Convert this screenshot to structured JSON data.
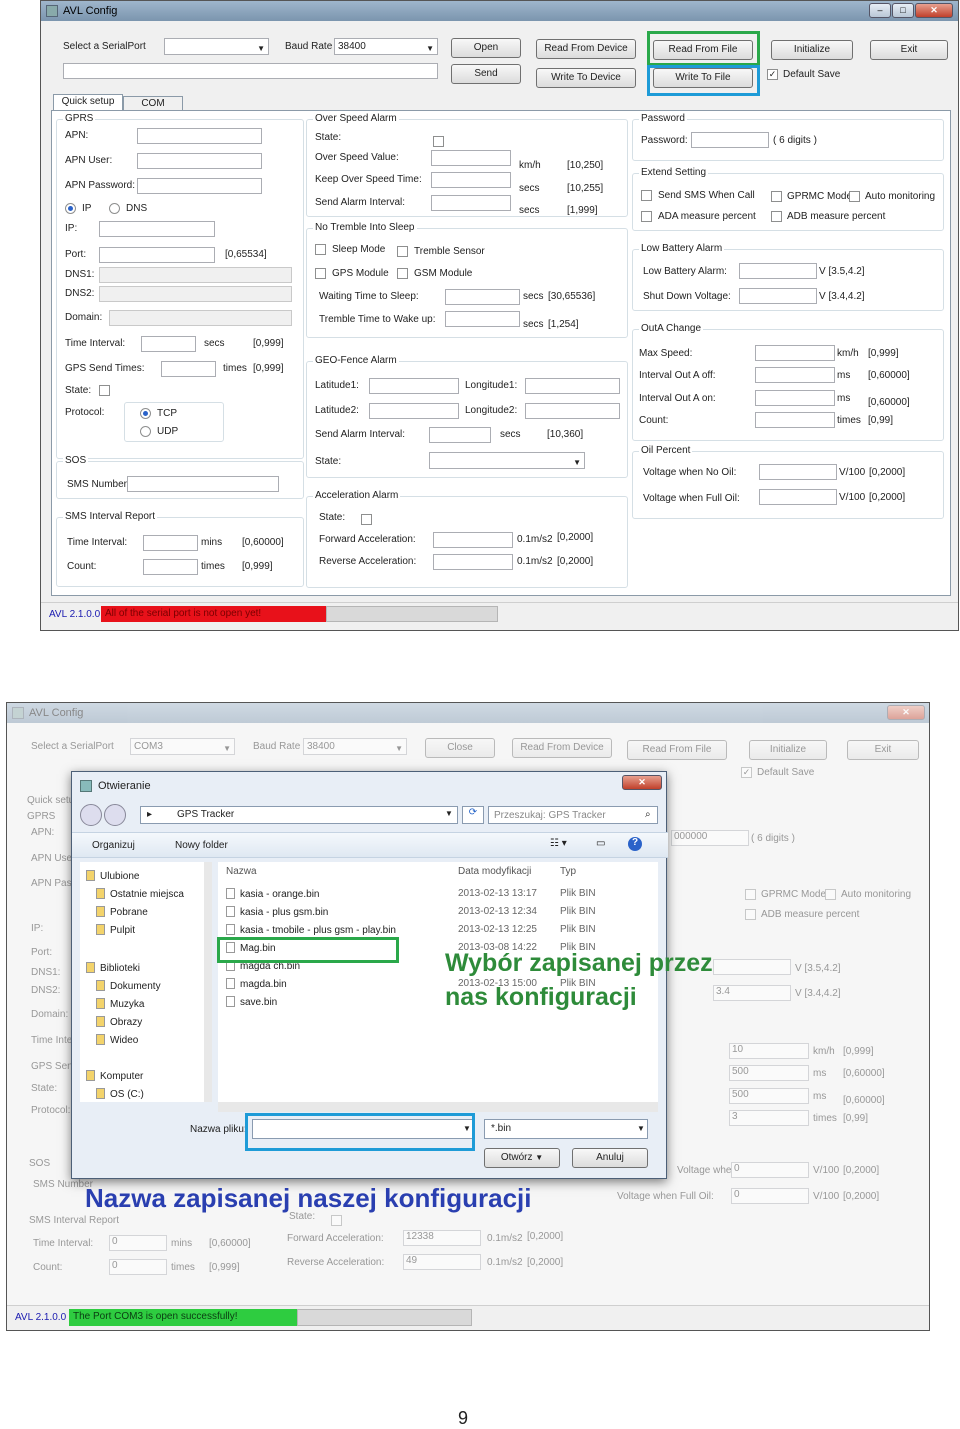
{
  "top": {
    "title": "AVL Config",
    "serial_label": "Select a SerialPort",
    "serial_value": "",
    "baud_label": "Baud Rate",
    "baud_value": "38400",
    "open": "Open",
    "send": "Send",
    "read_device": "Read  From  Device",
    "write_device": "Write To Device",
    "read_file": "Read From File",
    "write_file": "Write To File",
    "initialize": "Initialize",
    "exit": "Exit",
    "default_save": "Default Save",
    "tab_quick": "Quick setup",
    "tab_com": "COM",
    "gprs": {
      "title": "GPRS",
      "apn": "APN:",
      "apn_user": "APN User:",
      "apn_password": "APN Password:",
      "ip_opt": "IP",
      "dns_opt": "DNS",
      "ip": "IP:",
      "port": "Port:",
      "port_range": "[0,65534]",
      "dns1": "DNS1:",
      "dns2": "DNS2:",
      "domain": "Domain:",
      "time_interval": "Time Interval:",
      "secs": "secs",
      "ti_range": "[0,999]",
      "gps_send": "GPS Send Times:",
      "times": "times",
      "gs_range": "[0,999]",
      "state": "State:",
      "protocol": "Protocol:",
      "tcp": "TCP",
      "udp": "UDP"
    },
    "sos": {
      "title": "SOS",
      "sms_number": "SMS Number"
    },
    "smsr": {
      "title": "SMS Interval Report",
      "time_interval": "Time Interval:",
      "mins": "mins",
      "ti_range": "[0,60000]",
      "count": "Count:",
      "times": "times",
      "c_range": "[0,999]"
    },
    "osa": {
      "title": "Over Speed Alarm",
      "state": "State:",
      "value": "Over Speed Value:",
      "kmh": "km/h",
      "v_range": "[10,250]",
      "keep": "Keep Over Speed Time:",
      "secs": "secs",
      "k_range": "[10,255]",
      "send": "Send Alarm Interval:",
      "s_range": "[1,999]"
    },
    "nts": {
      "title": "No Tremble Into Sleep",
      "sleep_mode": "Sleep Mode",
      "tremble_sensor": "Tremble Sensor",
      "gps_module": "GPS Module",
      "gsm_module": "GSM Module",
      "waiting": "Waiting Time to Sleep:",
      "w_unit": "secs",
      "w_range": "[30,65536]",
      "tremble": "Tremble Time to Wake up:",
      "t_unit": "secs",
      "t_range": "[1,254]"
    },
    "geo": {
      "title": "GEO-Fence Alarm",
      "lat1": "Latitude1:",
      "lon1": "Longitude1:",
      "lat2": "Latitude2:",
      "lon2": "Longitude2:",
      "send": "Send Alarm Interval:",
      "secs": "secs",
      "s_range": "[10,360]",
      "state": "State:"
    },
    "acc": {
      "title": "Acceleration Alarm",
      "state": "State:",
      "forward": "Forward Acceleration:",
      "unit": "0.1m/s2",
      "f_range": "[0,2000]",
      "reverse": "Reverse Acceleration:",
      "r_range": "[0,2000]"
    },
    "pwd": {
      "title": "Password",
      "label": "Password:",
      "hint": "( 6 digits )"
    },
    "ext": {
      "title": "Extend Setting",
      "send_sms": "Send SMS When Call",
      "gprmc": "GPRMC Mode",
      "auto": "Auto monitoring",
      "ada": "ADA measure percent",
      "adb": "ADB measure percent"
    },
    "lba": {
      "title": "Low Battery Alarm",
      "low": "Low Battery Alarm:",
      "l_range": "V [3.5,4.2]",
      "shut": "Shut Down Voltage:",
      "s_range": "V [3.4,4.2]"
    },
    "outa": {
      "title": "OutA Change",
      "max": "Max Speed:",
      "kmh": "km/h",
      "m_range": "[0,999]",
      "off": "Interval Out A off:",
      "ms": "ms",
      "off_range": "[0,60000]",
      "on": "Interval Out A on:",
      "on_range": "[0,60000]",
      "count": "Count:",
      "times": "times",
      "c_range": "[0,99]"
    },
    "oil": {
      "title": "Oil Percent",
      "no_oil": "Voltage when No Oil:",
      "full_oil": "Voltage when Full Oil:",
      "unit": "V/100",
      "n_range": "[0,2000]",
      "f_range": "[0,2000]"
    },
    "status_version": "AVL 2.1.0.0",
    "status_msg": "All of the serial port is not open yet!"
  },
  "bottom": {
    "title": "AVL Config",
    "serial_value": "COM3",
    "close": "Close",
    "status_version": "AVL 2.1.0.0",
    "status_msg": "The Port COM3 is open successfully!",
    "password_value": "000000",
    "low_battery_value": "",
    "shut_down_value": "3.4",
    "max_speed_value": "10",
    "off_value": "500",
    "on_value": "500",
    "count_value": "3",
    "no_oil_value": "0",
    "full_oil_value": "0",
    "forward_value": "12338",
    "reverse_value": "49",
    "sms_time_value": "0",
    "sms_count_value": "0",
    "sms_number_label": "SMS Number",
    "sms_ir_title": "SMS Interval Report",
    "dialog": {
      "title": "Otwieranie",
      "path": "GPS Tracker",
      "search_placeholder": "Przeszukaj: GPS Tracker",
      "organize": "Organizuj",
      "new_folder": "Nowy folder",
      "nav": [
        "Ulubione",
        "Ostatnie miejsca",
        "Pobrane",
        "Pulpit",
        "Biblioteki",
        "Dokumenty",
        "Muzyka",
        "Obrazy",
        "Wideo",
        "Komputer",
        "OS (C:)"
      ],
      "col_name": "Nazwa",
      "col_date": "Data modyfikacji",
      "col_type": "Typ",
      "files": [
        {
          "name": "kasia - orange.bin",
          "date": "2013-02-13 13:17",
          "type": "Plik BIN"
        },
        {
          "name": "kasia - plus gsm.bin",
          "date": "2013-02-13 12:34",
          "type": "Plik BIN"
        },
        {
          "name": "kasia - tmobile - plus gsm - play.bin",
          "date": "2013-02-13 12:25",
          "type": "Plik BIN"
        },
        {
          "name": "Mag.bin",
          "date": "2013-03-08 14:22",
          "type": "Plik BIN"
        },
        {
          "name": "magda ch.bin",
          "date": "",
          "type": ""
        },
        {
          "name": "magda.bin",
          "date": "2013-02-13 15:00",
          "type": "Plik BIN"
        },
        {
          "name": "save.bin",
          "date": "",
          "type": ""
        }
      ],
      "filename_label": "Nazwa pliku:",
      "filename_value": "",
      "filter": "*.bin",
      "open": "Otwórz",
      "cancel": "Anuluj"
    },
    "annotation1_line1": "Wybór zapisanej przez",
    "annotation1_line2": "nas konfiguracji",
    "annotation2": "Nazwa zapisanej naszej konfiguracji"
  },
  "page_number": "9",
  "colors": {
    "green": "#2aa84a",
    "blue": "#1e9bd7",
    "status_red": "#e8111a",
    "status_green": "#2ecc40",
    "annot_green": "#2e8b3a",
    "annot_blue": "#2a3fb0"
  }
}
